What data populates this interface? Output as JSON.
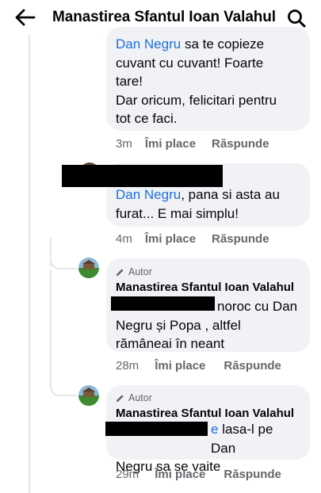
{
  "header": {
    "title": "Manastirea Sfantul Ioan Valahul"
  },
  "comments": [
    {
      "mention": "Dan Negru",
      "text_after_mention": " sa te copieze",
      "lines": [
        "cuvant cu cuvant! Foarte",
        "tare!",
        "Dar oricum, felicitari pentru",
        "tot ce faci."
      ],
      "time": "3m",
      "like": "Îmi place",
      "reply": "Răspunde"
    },
    {
      "mention": "Dan Negru",
      "text_after_mention": ", pana si asta au",
      "lines": [
        "furat... E mai simplu!"
      ],
      "time": "4m",
      "like": "Îmi place",
      "reply": "Răspunde"
    },
    {
      "author_tag": "Autor",
      "author": "Manastirea Sfantul Ioan Valahul",
      "line1_after_redact": "noroc cu Dan",
      "lines": [
        "Negru și Popa , altfel",
        "rămâneai în neant"
      ],
      "time": "28m",
      "like": "Îmi place",
      "reply": "Răspunde"
    },
    {
      "author_tag": "Autor",
      "author": "Manastirea Sfantul Ioan Valahul",
      "partial_mention": "e",
      "line1_after_redact": " lasa-l pe Dan",
      "lines": [
        "Negru sa se vaite"
      ],
      "time": "29m",
      "like": "Îmi place",
      "reply": "Răspunde"
    }
  ],
  "colors": {
    "mention": "#216fdb",
    "bubble": "#f0f2f5",
    "meta": "#65676b"
  },
  "icons": {
    "back": "arrow-left-icon",
    "search": "search-icon",
    "author": "pencil-icon"
  }
}
